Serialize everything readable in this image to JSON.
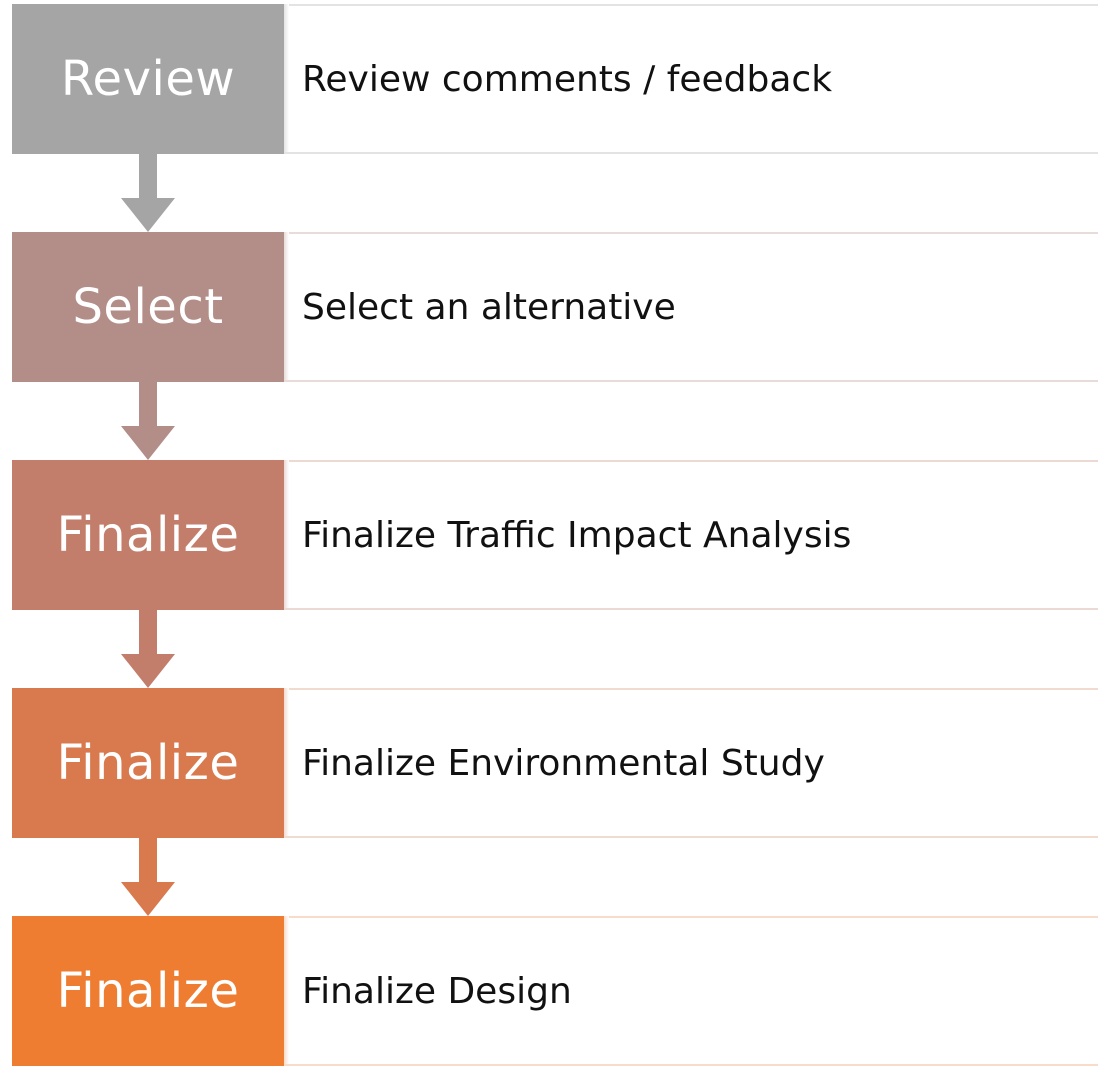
{
  "steps": [
    {
      "label": "Review",
      "description": "Review comments / feedback",
      "color": "#a5a5a5",
      "line_color": "#e3e3e3"
    },
    {
      "label": "Select",
      "description": "Select an alternative",
      "color": "#b38d87",
      "line_color": "#e7dcda"
    },
    {
      "label": "Finalize",
      "description": "Finalize Traffic Impact Analysis",
      "color": "#c37e6b",
      "line_color": "#ecd9d3"
    },
    {
      "label": "Finalize",
      "description": "Finalize Environmental Study",
      "color": "#d87a4e",
      "line_color": "#f1dace"
    },
    {
      "label": "Finalize",
      "description": "Finalize Design",
      "color": "#ee7d31",
      "line_color": "#f8dcc9"
    }
  ]
}
